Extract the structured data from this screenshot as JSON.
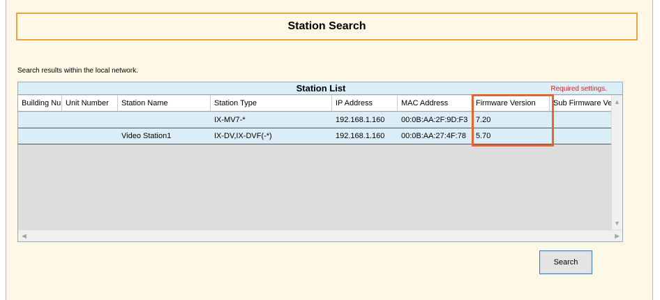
{
  "title": "Station Search",
  "search_note": "Search results within the local network.",
  "list": {
    "title": "Station List",
    "required_label": "Required settings.",
    "columns": [
      "Building Nu",
      "Unit Number",
      "Station Name",
      "Station Type",
      "IP Address",
      "MAC Address",
      "Firmware Version",
      "Sub Firmware Version"
    ],
    "rows": [
      [
        "",
        "",
        "",
        "IX-MV7-*",
        "192.168.1.160",
        "00:0B:AA:2F:9D:F3",
        "7.20",
        ""
      ],
      [
        "",
        "",
        "Video Station1",
        "IX-DV,IX-DVF(-*)",
        "192.168.1.160",
        "00:0B:AA:27:4F:78",
        "5.70",
        ""
      ]
    ]
  },
  "scroll_icons": {
    "up": "▲-up-arrow-icon",
    "down": "▼-down-arrow-icon",
    "left": "◀-left-arrow-icon",
    "right": "▶-right-arrow-icon"
  },
  "highlight_color": "#e8642c",
  "title_border_color": "#f0a33a",
  "required_color": "#e02020",
  "search_button_label": "Search"
}
